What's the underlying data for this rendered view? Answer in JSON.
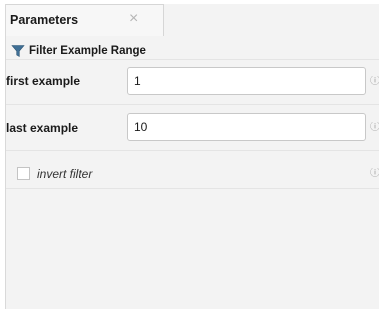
{
  "panel": {
    "tab_label": "Parameters",
    "tab_close_symbol": "×"
  },
  "operator": {
    "icon": "filter-icon",
    "title": "Filter Example Range"
  },
  "parameters": [
    {
      "label": "first example",
      "value": "1",
      "info_icon": "info-icon"
    },
    {
      "label": "last example",
      "value": "10",
      "info_icon": "info-icon"
    }
  ],
  "invert_filter": {
    "label": "invert filter",
    "checked": false,
    "info_icon": "info-icon"
  },
  "colors": {
    "panel_background": "#f3f3f3",
    "input_background": "#ffffff",
    "filter_icon": "#3f6f95"
  }
}
